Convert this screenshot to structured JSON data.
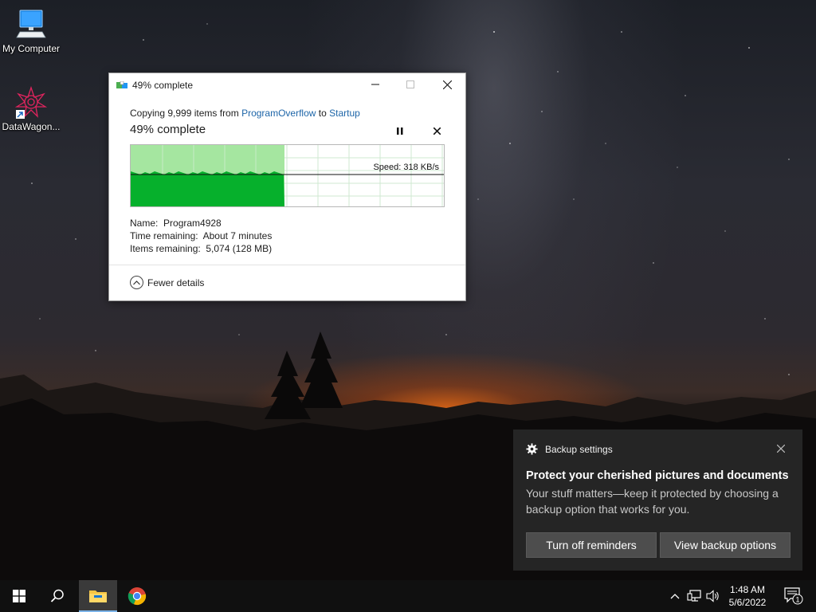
{
  "desktop": {
    "icons": [
      {
        "label": "My Computer",
        "icon": "computer-icon"
      },
      {
        "label": "DataWagon...",
        "icon": "datawagon-icon"
      }
    ]
  },
  "copy_dialog": {
    "title": "49% complete",
    "copy_prefix": "Copying 9,999 items from ",
    "source": "ProgramOverflow",
    "copy_mid": " to ",
    "destination": "Startup",
    "status": "49% complete",
    "progress_fraction": 0.49,
    "speed_text": "Speed: 318 KB/s",
    "name_label": "Name:",
    "name_value": "Program4928",
    "time_label": "Time remaining:",
    "time_value": "About 7 minutes",
    "items_label": "Items remaining:",
    "items_value": "5,074 (128 MB)",
    "fewer_details": "Fewer details",
    "colors": {
      "progress_fill": "#a5e6a0",
      "speed_area": "#06b02c",
      "link": "#1d65a8"
    }
  },
  "toast": {
    "app_name": "Backup settings",
    "title": "Protect your cherished pictures and documents",
    "body": "Your stuff matters—keep it protected by choosing a backup option that works for you.",
    "button_1": "Turn off reminders",
    "button_2": "View backup options"
  },
  "taskbar": {
    "apps": [
      "start-icon",
      "search-icon",
      "file-explorer-icon",
      "chrome-icon"
    ],
    "time": "1:48 AM",
    "date": "5/6/2022",
    "notification_count": "1"
  }
}
